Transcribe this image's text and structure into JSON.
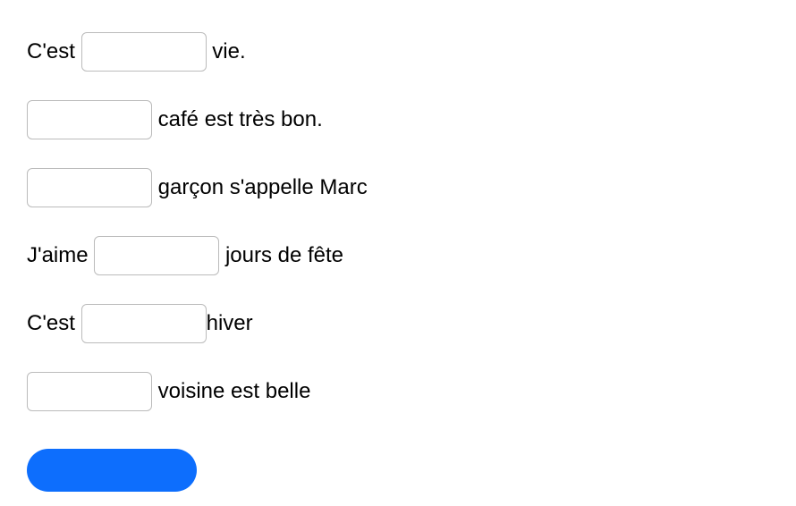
{
  "items": [
    {
      "before": "C'est ",
      "after": " vie."
    },
    {
      "before": "",
      "after": " café est très bon."
    },
    {
      "before": "",
      "after": " garçon s'appelle Marc"
    },
    {
      "before": "J'aime ",
      "after": " jours de fête"
    },
    {
      "before": "C'est ",
      "after": "hiver"
    },
    {
      "before": "",
      "after": " voisine est belle"
    }
  ],
  "submit_label": ""
}
